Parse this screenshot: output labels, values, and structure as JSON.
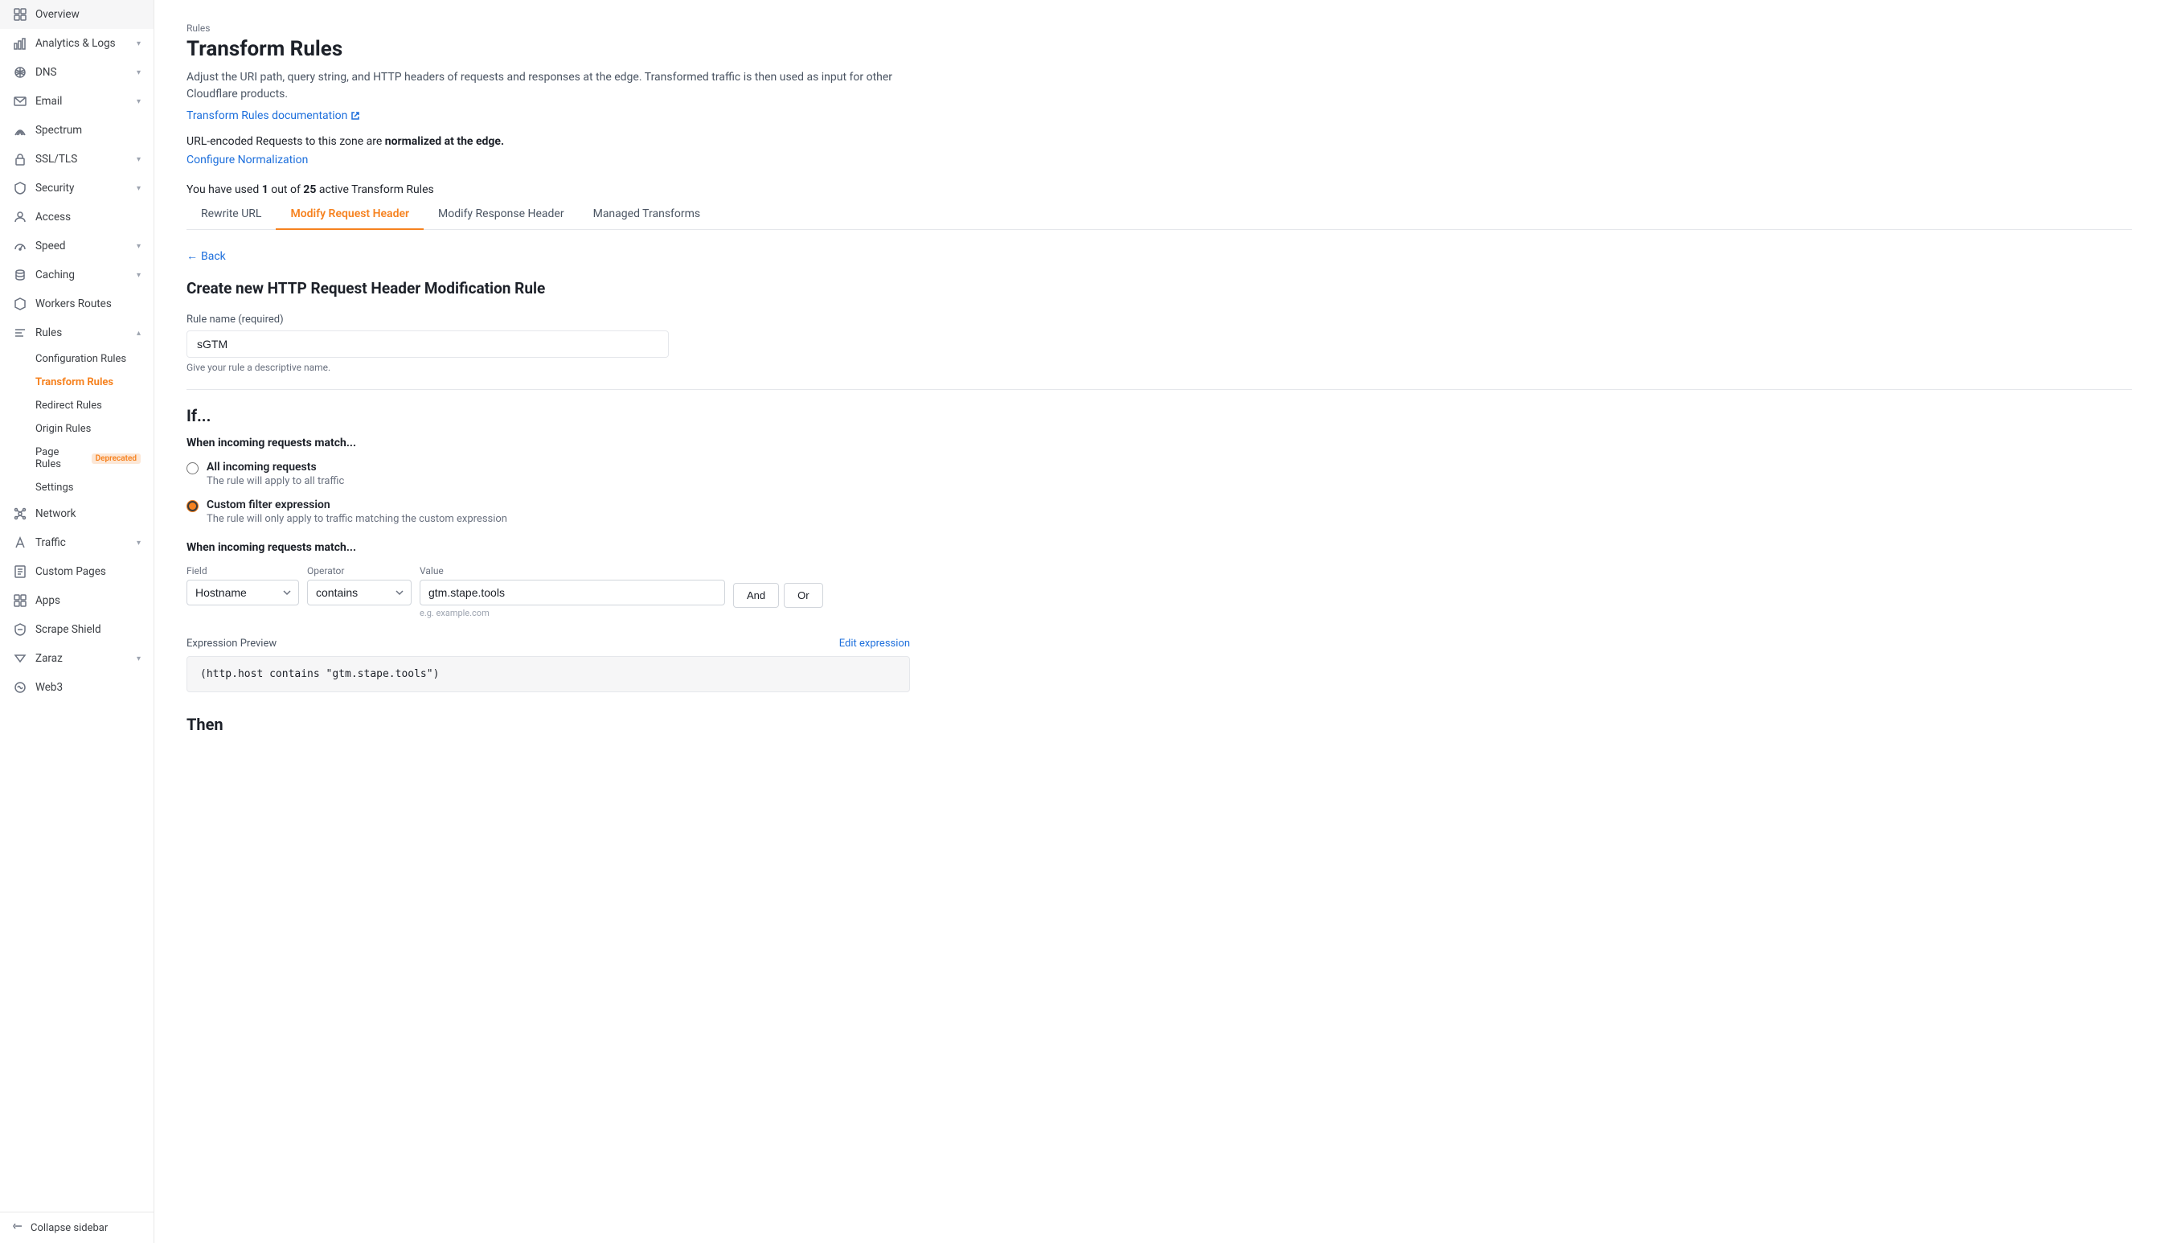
{
  "sidebar": {
    "items": [
      {
        "id": "overview",
        "label": "Overview",
        "icon": "grid",
        "hasChildren": false
      },
      {
        "id": "analytics-logs",
        "label": "Analytics & Logs",
        "icon": "bar-chart",
        "hasChildren": true
      },
      {
        "id": "dns",
        "label": "DNS",
        "icon": "dns",
        "hasChildren": true
      },
      {
        "id": "email",
        "label": "Email",
        "icon": "email",
        "hasChildren": true
      },
      {
        "id": "spectrum",
        "label": "Spectrum",
        "icon": "spectrum",
        "hasChildren": false
      },
      {
        "id": "ssl-tls",
        "label": "SSL/TLS",
        "icon": "lock",
        "hasChildren": true
      },
      {
        "id": "security",
        "label": "Security",
        "icon": "shield",
        "hasChildren": true
      },
      {
        "id": "access",
        "label": "Access",
        "icon": "access",
        "hasChildren": false
      },
      {
        "id": "speed",
        "label": "Speed",
        "icon": "speed",
        "hasChildren": true
      },
      {
        "id": "caching",
        "label": "Caching",
        "icon": "caching",
        "hasChildren": true
      },
      {
        "id": "workers-routes",
        "label": "Workers Routes",
        "icon": "workers",
        "hasChildren": false
      },
      {
        "id": "rules",
        "label": "Rules",
        "icon": "rules",
        "hasChildren": true,
        "expanded": true
      },
      {
        "id": "network",
        "label": "Network",
        "icon": "network",
        "hasChildren": false
      },
      {
        "id": "traffic",
        "label": "Traffic",
        "icon": "traffic",
        "hasChildren": true
      },
      {
        "id": "custom-pages",
        "label": "Custom Pages",
        "icon": "custom-pages",
        "hasChildren": false
      },
      {
        "id": "apps",
        "label": "Apps",
        "icon": "apps",
        "hasChildren": false
      },
      {
        "id": "scrape-shield",
        "label": "Scrape Shield",
        "icon": "scrape-shield",
        "hasChildren": false
      },
      {
        "id": "zaraz",
        "label": "Zaraz",
        "icon": "zaraz",
        "hasChildren": true
      },
      {
        "id": "web3",
        "label": "Web3",
        "icon": "web3",
        "hasChildren": false
      }
    ],
    "sub_items": [
      {
        "id": "configuration-rules",
        "label": "Configuration Rules",
        "parent": "rules"
      },
      {
        "id": "transform-rules",
        "label": "Transform Rules",
        "parent": "rules",
        "active": true
      },
      {
        "id": "redirect-rules",
        "label": "Redirect Rules",
        "parent": "rules"
      },
      {
        "id": "origin-rules",
        "label": "Origin Rules",
        "parent": "rules"
      },
      {
        "id": "page-rules",
        "label": "Page Rules",
        "parent": "rules",
        "badge": "Deprecated"
      },
      {
        "id": "settings",
        "label": "Settings",
        "parent": "rules"
      }
    ],
    "collapse_label": "Collapse sidebar"
  },
  "page": {
    "section_label": "Rules",
    "title": "Transform Rules",
    "description": "Adjust the URI path, query string, and HTTP headers of requests and responses at the edge. Transformed traffic is then used as input for other Cloudflare products.",
    "doc_link_label": "Transform Rules documentation",
    "normalization_text_before": "URL-encoded Requests to this zone are ",
    "normalization_text_bold": "normalized at the edge.",
    "configure_link_label": "Configure Normalization",
    "usage_text_before": "You have used ",
    "usage_count": "1",
    "usage_separator": " out of ",
    "usage_max": "25",
    "usage_text_after": " active Transform Rules"
  },
  "tabs": [
    {
      "id": "rewrite-url",
      "label": "Rewrite URL",
      "active": false
    },
    {
      "id": "modify-request-header",
      "label": "Modify Request Header",
      "active": true
    },
    {
      "id": "modify-response-header",
      "label": "Modify Response Header",
      "active": false
    },
    {
      "id": "managed-transforms",
      "label": "Managed Transforms",
      "active": false
    }
  ],
  "back_label": "Back",
  "form": {
    "section_title": "Create new HTTP Request Header Modification Rule",
    "rule_name_label": "Rule name (required)",
    "rule_name_value": "sGTM",
    "rule_name_hint": "Give your rule a descriptive name.",
    "if_label": "If...",
    "when_label": "When incoming requests match...",
    "radio_all_label": "All incoming requests",
    "radio_all_desc": "The rule will apply to all traffic",
    "radio_custom_label": "Custom filter expression",
    "radio_custom_desc": "The rule will only apply to traffic matching the custom expression",
    "filter_when_label": "When incoming requests match...",
    "field_label": "Field",
    "operator_label": "Operator",
    "value_label": "Value",
    "field_value": "Hostname",
    "operator_value": "contains",
    "filter_value": "gtm.stape.tools",
    "filter_hint": "e.g. example.com",
    "and_button": "And",
    "or_button": "Or",
    "expr_preview_label": "Expression Preview",
    "edit_expr_label": "Edit expression",
    "expr_preview_code": "(http.host contains \"gtm.stape.tools\")",
    "then_label": "Then"
  }
}
